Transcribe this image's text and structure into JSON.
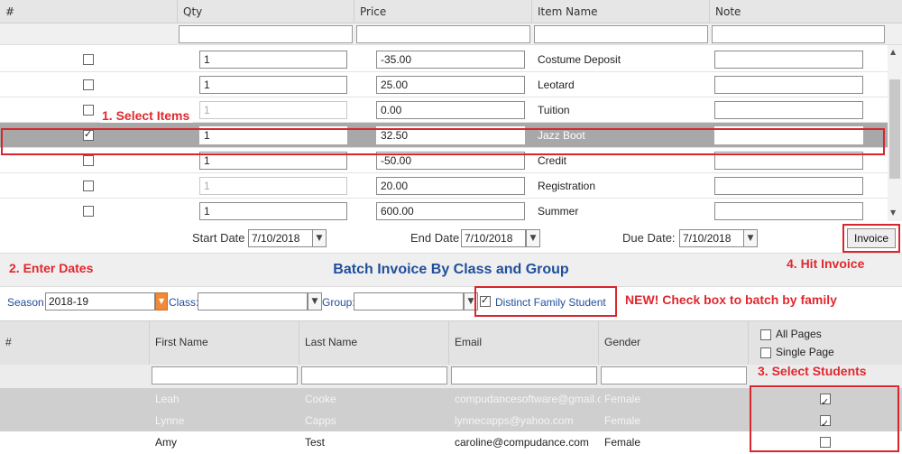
{
  "top_grid": {
    "columns": [
      "#",
      "Qty",
      "Price",
      "Item Name",
      "Note"
    ],
    "rows": [
      {
        "checked": false,
        "qty": "1",
        "price": "-35.00",
        "item": "Costume Deposit",
        "dim": false,
        "selected": false
      },
      {
        "checked": false,
        "qty": "1",
        "price": "25.00",
        "item": "Leotard",
        "dim": false,
        "selected": false
      },
      {
        "checked": false,
        "qty": "1",
        "price": "0.00",
        "item": "Tuition",
        "dim": true,
        "selected": false
      },
      {
        "checked": true,
        "qty": "1",
        "price": "32.50",
        "item": "Jazz Boot",
        "dim": false,
        "selected": true
      },
      {
        "checked": false,
        "qty": "1",
        "price": "-50.00",
        "item": "Credit",
        "dim": false,
        "selected": false
      },
      {
        "checked": false,
        "qty": "1",
        "price": "20.00",
        "item": "Registration",
        "dim": true,
        "selected": false
      },
      {
        "checked": false,
        "qty": "1",
        "price": "600.00",
        "item": "Summer",
        "dim": false,
        "selected": false
      }
    ]
  },
  "dates": {
    "start_label": "Start Date",
    "start_value": "7/10/2018",
    "end_label": "End Date",
    "end_value": "7/10/2018",
    "due_label": "Due Date:",
    "due_value": "7/10/2018",
    "invoice_label": "Invoice"
  },
  "annotations": {
    "select_items": "1. Select Items",
    "enter_dates": "2. Enter Dates",
    "select_students": "3. Select Students",
    "hit_invoice": "4. Hit Invoice",
    "new_family": "NEW! Check box to batch by family"
  },
  "section_title": "Batch Invoice By Class and Group",
  "filters": {
    "season_label": "Season:",
    "season_value": "2018-19",
    "class_label": "Class:",
    "class_value": "",
    "group_label": "Group:",
    "group_value": "",
    "distinct_label": "Distinct Family Student",
    "distinct_checked": true
  },
  "student_grid": {
    "columns": [
      "#",
      "First Name",
      "Last Name",
      "Email",
      "Gender"
    ],
    "all_pages": "All Pages",
    "single_page": "Single Page",
    "rows": [
      {
        "first": "Leah",
        "last": "Cooke",
        "email": "compudancesoftware@gmail.com",
        "gender": "Female",
        "checked": true,
        "grey": true
      },
      {
        "first": "Lynne",
        "last": "Capps",
        "email": "lynnecapps@yahoo.com",
        "gender": "Female",
        "checked": true,
        "grey": true
      },
      {
        "first": "Amy",
        "last": "Test",
        "email": "caroline@compudance.com",
        "gender": "Female",
        "checked": false,
        "grey": false
      }
    ]
  },
  "colors": {
    "accent_red": "#d7262d",
    "title_blue": "#1f4f9c",
    "selected_row": "#a8a8a8",
    "orange": "#f08a3a"
  }
}
